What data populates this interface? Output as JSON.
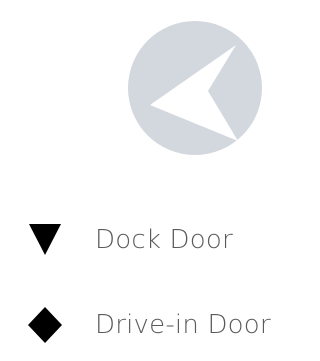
{
  "logo": {
    "icon": "chevron-left-logo",
    "color": "#d3d7de"
  },
  "legend": {
    "items": [
      {
        "icon": "triangle-down-icon",
        "label": "Dock Door",
        "color": "#000000"
      },
      {
        "icon": "diamond-icon",
        "label": "Drive-in Door",
        "color": "#000000"
      }
    ]
  },
  "colors": {
    "label_text": "#5a5a5a",
    "background": "#ffffff"
  }
}
